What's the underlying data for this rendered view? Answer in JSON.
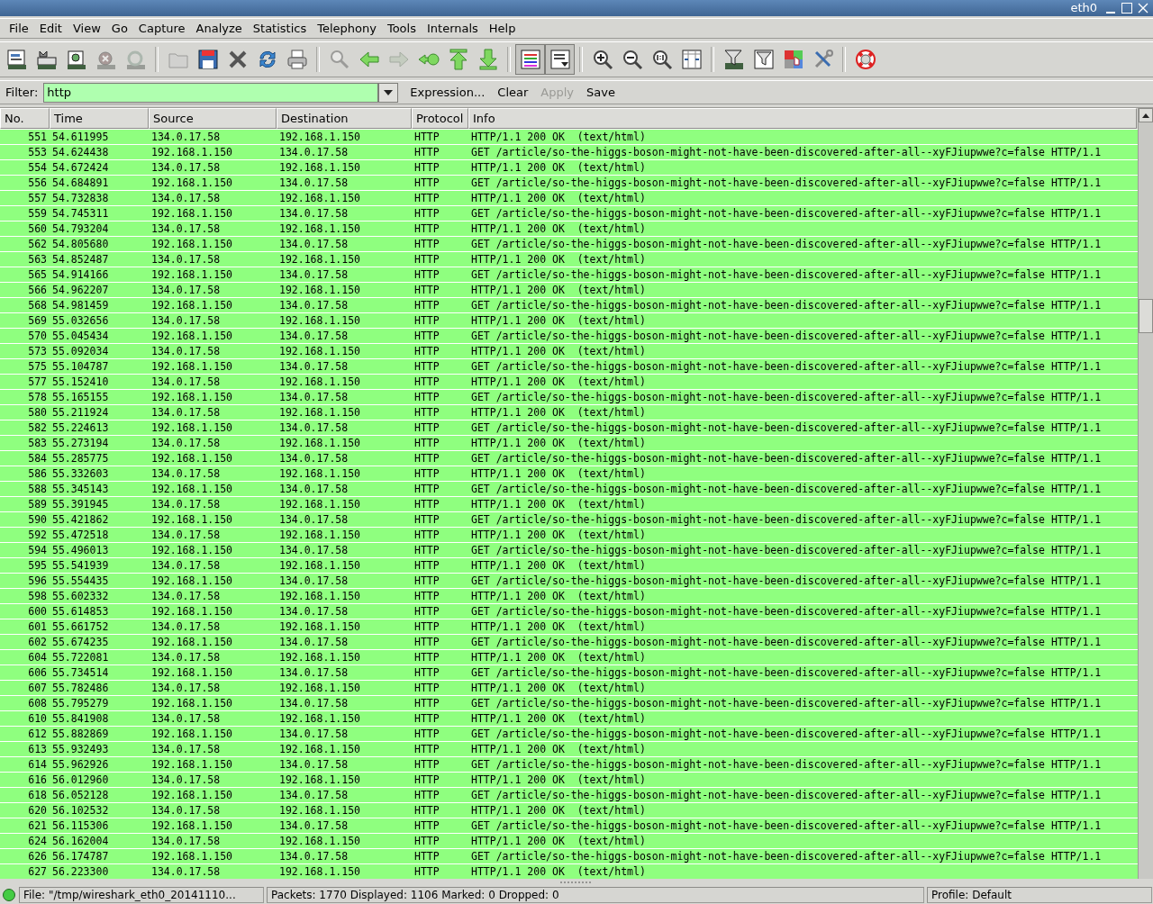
{
  "window": {
    "title": "eth0"
  },
  "menu": [
    {
      "label": "File",
      "selected": false
    },
    {
      "label": "Edit",
      "selected": false
    },
    {
      "label": "View",
      "selected": false
    },
    {
      "label": "Go",
      "selected": false
    },
    {
      "label": "Capture",
      "selected": false
    },
    {
      "label": "Analyze",
      "selected": false
    },
    {
      "label": "Statistics",
      "selected": false
    },
    {
      "label": "Telephony",
      "selected": false
    },
    {
      "label": "Tools",
      "selected": false
    },
    {
      "label": "Internals",
      "selected": false
    },
    {
      "label": "Help",
      "selected": false
    }
  ],
  "toolbar": [
    {
      "kind": "interfaces",
      "disabled": false,
      "pressed": false
    },
    {
      "kind": "options",
      "disabled": false,
      "pressed": false
    },
    {
      "kind": "start",
      "disabled": false,
      "pressed": false
    },
    {
      "kind": "stop",
      "disabled": true,
      "pressed": false
    },
    {
      "kind": "restart",
      "disabled": true,
      "pressed": false
    },
    {
      "kind": "separator"
    },
    {
      "kind": "open",
      "disabled": true,
      "pressed": false
    },
    {
      "kind": "save",
      "disabled": false,
      "pressed": false
    },
    {
      "kind": "close",
      "disabled": false,
      "pressed": false
    },
    {
      "kind": "reload",
      "disabled": false,
      "pressed": false
    },
    {
      "kind": "print",
      "disabled": false,
      "pressed": false
    },
    {
      "kind": "separator"
    },
    {
      "kind": "find",
      "disabled": true,
      "pressed": false
    },
    {
      "kind": "back",
      "disabled": false,
      "pressed": false
    },
    {
      "kind": "forward",
      "disabled": true,
      "pressed": false
    },
    {
      "kind": "goto",
      "disabled": false,
      "pressed": false
    },
    {
      "kind": "first",
      "disabled": false,
      "pressed": false
    },
    {
      "kind": "last",
      "disabled": false,
      "pressed": false
    },
    {
      "kind": "separator"
    },
    {
      "kind": "colorize",
      "disabled": false,
      "pressed": true
    },
    {
      "kind": "autoscroll",
      "disabled": false,
      "pressed": true
    },
    {
      "kind": "separator"
    },
    {
      "kind": "zoomin",
      "disabled": false,
      "pressed": false
    },
    {
      "kind": "zoomout",
      "disabled": false,
      "pressed": false
    },
    {
      "kind": "zoomnormal",
      "disabled": false,
      "pressed": false
    },
    {
      "kind": "resize",
      "disabled": false,
      "pressed": false
    },
    {
      "kind": "separator"
    },
    {
      "kind": "capturefilter",
      "disabled": false,
      "pressed": false
    },
    {
      "kind": "displayfilter",
      "disabled": false,
      "pressed": false
    },
    {
      "kind": "coloring",
      "disabled": false,
      "pressed": false
    },
    {
      "kind": "preferences",
      "disabled": false,
      "pressed": false
    },
    {
      "kind": "separator"
    },
    {
      "kind": "help",
      "disabled": false,
      "pressed": false
    }
  ],
  "filter": {
    "label": "Filter:",
    "value": "http",
    "valid": true,
    "buttons": [
      {
        "label": "Expression...",
        "disabled": false
      },
      {
        "label": "Clear",
        "disabled": false
      },
      {
        "label": "Apply",
        "disabled": true
      },
      {
        "label": "Save",
        "disabled": false
      }
    ]
  },
  "table": {
    "columns": [
      "No.",
      "Time",
      "Source",
      "Destination",
      "Protocol",
      "Info"
    ],
    "rows": [
      {
        "color": "#8fff7f",
        "cells": [
          "551",
          "54.611995",
          "134.0.17.58",
          "192.168.1.150",
          "HTTP",
          "HTTP/1.1 200 OK  (text/html)"
        ]
      },
      {
        "color": "#8fff7f",
        "cells": [
          "553",
          "54.624438",
          "192.168.1.150",
          "134.0.17.58",
          "HTTP",
          "GET /article/so-the-higgs-boson-might-not-have-been-discovered-after-all--xyFJiupwwe?c=false HTTP/1.1"
        ]
      },
      {
        "color": "#8fff7f",
        "cells": [
          "554",
          "54.672424",
          "134.0.17.58",
          "192.168.1.150",
          "HTTP",
          "HTTP/1.1 200 OK  (text/html)"
        ]
      },
      {
        "color": "#8fff7f",
        "cells": [
          "556",
          "54.684891",
          "192.168.1.150",
          "134.0.17.58",
          "HTTP",
          "GET /article/so-the-higgs-boson-might-not-have-been-discovered-after-all--xyFJiupwwe?c=false HTTP/1.1"
        ]
      },
      {
        "color": "#8fff7f",
        "cells": [
          "557",
          "54.732838",
          "134.0.17.58",
          "192.168.1.150",
          "HTTP",
          "HTTP/1.1 200 OK  (text/html)"
        ]
      },
      {
        "color": "#8fff7f",
        "cells": [
          "559",
          "54.745311",
          "192.168.1.150",
          "134.0.17.58",
          "HTTP",
          "GET /article/so-the-higgs-boson-might-not-have-been-discovered-after-all--xyFJiupwwe?c=false HTTP/1.1"
        ]
      },
      {
        "color": "#8fff7f",
        "cells": [
          "560",
          "54.793204",
          "134.0.17.58",
          "192.168.1.150",
          "HTTP",
          "HTTP/1.1 200 OK  (text/html)"
        ]
      },
      {
        "color": "#8fff7f",
        "cells": [
          "562",
          "54.805680",
          "192.168.1.150",
          "134.0.17.58",
          "HTTP",
          "GET /article/so-the-higgs-boson-might-not-have-been-discovered-after-all--xyFJiupwwe?c=false HTTP/1.1"
        ]
      },
      {
        "color": "#8fff7f",
        "cells": [
          "563",
          "54.852487",
          "134.0.17.58",
          "192.168.1.150",
          "HTTP",
          "HTTP/1.1 200 OK  (text/html)"
        ]
      },
      {
        "color": "#8fff7f",
        "cells": [
          "565",
          "54.914166",
          "192.168.1.150",
          "134.0.17.58",
          "HTTP",
          "GET /article/so-the-higgs-boson-might-not-have-been-discovered-after-all--xyFJiupwwe?c=false HTTP/1.1"
        ]
      },
      {
        "color": "#8fff7f",
        "cells": [
          "566",
          "54.962207",
          "134.0.17.58",
          "192.168.1.150",
          "HTTP",
          "HTTP/1.1 200 OK  (text/html)"
        ]
      },
      {
        "color": "#8fff7f",
        "cells": [
          "568",
          "54.981459",
          "192.168.1.150",
          "134.0.17.58",
          "HTTP",
          "GET /article/so-the-higgs-boson-might-not-have-been-discovered-after-all--xyFJiupwwe?c=false HTTP/1.1"
        ]
      },
      {
        "color": "#8fff7f",
        "cells": [
          "569",
          "55.032656",
          "134.0.17.58",
          "192.168.1.150",
          "HTTP",
          "HTTP/1.1 200 OK  (text/html)"
        ]
      },
      {
        "color": "#8fff7f",
        "cells": [
          "570",
          "55.045434",
          "192.168.1.150",
          "134.0.17.58",
          "HTTP",
          "GET /article/so-the-higgs-boson-might-not-have-been-discovered-after-all--xyFJiupwwe?c=false HTTP/1.1"
        ]
      },
      {
        "color": "#8fff7f",
        "cells": [
          "573",
          "55.092034",
          "134.0.17.58",
          "192.168.1.150",
          "HTTP",
          "HTTP/1.1 200 OK  (text/html)"
        ]
      },
      {
        "color": "#8fff7f",
        "cells": [
          "575",
          "55.104787",
          "192.168.1.150",
          "134.0.17.58",
          "HTTP",
          "GET /article/so-the-higgs-boson-might-not-have-been-discovered-after-all--xyFJiupwwe?c=false HTTP/1.1"
        ]
      },
      {
        "color": "#8fff7f",
        "cells": [
          "577",
          "55.152410",
          "134.0.17.58",
          "192.168.1.150",
          "HTTP",
          "HTTP/1.1 200 OK  (text/html)"
        ]
      },
      {
        "color": "#8fff7f",
        "cells": [
          "578",
          "55.165155",
          "192.168.1.150",
          "134.0.17.58",
          "HTTP",
          "GET /article/so-the-higgs-boson-might-not-have-been-discovered-after-all--xyFJiupwwe?c=false HTTP/1.1"
        ]
      },
      {
        "color": "#8fff7f",
        "cells": [
          "580",
          "55.211924",
          "134.0.17.58",
          "192.168.1.150",
          "HTTP",
          "HTTP/1.1 200 OK  (text/html)"
        ]
      },
      {
        "color": "#8fff7f",
        "cells": [
          "582",
          "55.224613",
          "192.168.1.150",
          "134.0.17.58",
          "HTTP",
          "GET /article/so-the-higgs-boson-might-not-have-been-discovered-after-all--xyFJiupwwe?c=false HTTP/1.1"
        ]
      },
      {
        "color": "#8fff7f",
        "cells": [
          "583",
          "55.273194",
          "134.0.17.58",
          "192.168.1.150",
          "HTTP",
          "HTTP/1.1 200 OK  (text/html)"
        ]
      },
      {
        "color": "#8fff7f",
        "cells": [
          "584",
          "55.285775",
          "192.168.1.150",
          "134.0.17.58",
          "HTTP",
          "GET /article/so-the-higgs-boson-might-not-have-been-discovered-after-all--xyFJiupwwe?c=false HTTP/1.1"
        ]
      },
      {
        "color": "#8fff7f",
        "cells": [
          "586",
          "55.332603",
          "134.0.17.58",
          "192.168.1.150",
          "HTTP",
          "HTTP/1.1 200 OK  (text/html)"
        ]
      },
      {
        "color": "#8fff7f",
        "cells": [
          "588",
          "55.345143",
          "192.168.1.150",
          "134.0.17.58",
          "HTTP",
          "GET /article/so-the-higgs-boson-might-not-have-been-discovered-after-all--xyFJiupwwe?c=false HTTP/1.1"
        ]
      },
      {
        "color": "#8fff7f",
        "cells": [
          "589",
          "55.391945",
          "134.0.17.58",
          "192.168.1.150",
          "HTTP",
          "HTTP/1.1 200 OK  (text/html)"
        ]
      },
      {
        "color": "#8fff7f",
        "cells": [
          "590",
          "55.421862",
          "192.168.1.150",
          "134.0.17.58",
          "HTTP",
          "GET /article/so-the-higgs-boson-might-not-have-been-discovered-after-all--xyFJiupwwe?c=false HTTP/1.1"
        ]
      },
      {
        "color": "#8fff7f",
        "cells": [
          "592",
          "55.472518",
          "134.0.17.58",
          "192.168.1.150",
          "HTTP",
          "HTTP/1.1 200 OK  (text/html)"
        ]
      },
      {
        "color": "#8fff7f",
        "cells": [
          "594",
          "55.496013",
          "192.168.1.150",
          "134.0.17.58",
          "HTTP",
          "GET /article/so-the-higgs-boson-might-not-have-been-discovered-after-all--xyFJiupwwe?c=false HTTP/1.1"
        ]
      },
      {
        "color": "#8fff7f",
        "cells": [
          "595",
          "55.541939",
          "134.0.17.58",
          "192.168.1.150",
          "HTTP",
          "HTTP/1.1 200 OK  (text/html)"
        ]
      },
      {
        "color": "#8fff7f",
        "cells": [
          "596",
          "55.554435",
          "192.168.1.150",
          "134.0.17.58",
          "HTTP",
          "GET /article/so-the-higgs-boson-might-not-have-been-discovered-after-all--xyFJiupwwe?c=false HTTP/1.1"
        ]
      },
      {
        "color": "#8fff7f",
        "cells": [
          "598",
          "55.602332",
          "134.0.17.58",
          "192.168.1.150",
          "HTTP",
          "HTTP/1.1 200 OK  (text/html)"
        ]
      },
      {
        "color": "#8fff7f",
        "cells": [
          "600",
          "55.614853",
          "192.168.1.150",
          "134.0.17.58",
          "HTTP",
          "GET /article/so-the-higgs-boson-might-not-have-been-discovered-after-all--xyFJiupwwe?c=false HTTP/1.1"
        ]
      },
      {
        "color": "#8fff7f",
        "cells": [
          "601",
          "55.661752",
          "134.0.17.58",
          "192.168.1.150",
          "HTTP",
          "HTTP/1.1 200 OK  (text/html)"
        ]
      },
      {
        "color": "#8fff7f",
        "cells": [
          "602",
          "55.674235",
          "192.168.1.150",
          "134.0.17.58",
          "HTTP",
          "GET /article/so-the-higgs-boson-might-not-have-been-discovered-after-all--xyFJiupwwe?c=false HTTP/1.1"
        ]
      },
      {
        "color": "#8fff7f",
        "cells": [
          "604",
          "55.722081",
          "134.0.17.58",
          "192.168.1.150",
          "HTTP",
          "HTTP/1.1 200 OK  (text/html)"
        ]
      },
      {
        "color": "#8fff7f",
        "cells": [
          "606",
          "55.734514",
          "192.168.1.150",
          "134.0.17.58",
          "HTTP",
          "GET /article/so-the-higgs-boson-might-not-have-been-discovered-after-all--xyFJiupwwe?c=false HTTP/1.1"
        ]
      },
      {
        "color": "#8fff7f",
        "cells": [
          "607",
          "55.782486",
          "134.0.17.58",
          "192.168.1.150",
          "HTTP",
          "HTTP/1.1 200 OK  (text/html)"
        ]
      },
      {
        "color": "#8fff7f",
        "cells": [
          "608",
          "55.795279",
          "192.168.1.150",
          "134.0.17.58",
          "HTTP",
          "GET /article/so-the-higgs-boson-might-not-have-been-discovered-after-all--xyFJiupwwe?c=false HTTP/1.1"
        ]
      },
      {
        "color": "#8fff7f",
        "cells": [
          "610",
          "55.841908",
          "134.0.17.58",
          "192.168.1.150",
          "HTTP",
          "HTTP/1.1 200 OK  (text/html)"
        ]
      },
      {
        "color": "#8fff7f",
        "cells": [
          "612",
          "55.882869",
          "192.168.1.150",
          "134.0.17.58",
          "HTTP",
          "GET /article/so-the-higgs-boson-might-not-have-been-discovered-after-all--xyFJiupwwe?c=false HTTP/1.1"
        ]
      },
      {
        "color": "#8fff7f",
        "cells": [
          "613",
          "55.932493",
          "134.0.17.58",
          "192.168.1.150",
          "HTTP",
          "HTTP/1.1 200 OK  (text/html)"
        ]
      },
      {
        "color": "#8fff7f",
        "cells": [
          "614",
          "55.962926",
          "192.168.1.150",
          "134.0.17.58",
          "HTTP",
          "GET /article/so-the-higgs-boson-might-not-have-been-discovered-after-all--xyFJiupwwe?c=false HTTP/1.1"
        ]
      },
      {
        "color": "#8fff7f",
        "cells": [
          "616",
          "56.012960",
          "134.0.17.58",
          "192.168.1.150",
          "HTTP",
          "HTTP/1.1 200 OK  (text/html)"
        ]
      },
      {
        "color": "#8fff7f",
        "cells": [
          "618",
          "56.052128",
          "192.168.1.150",
          "134.0.17.58",
          "HTTP",
          "GET /article/so-the-higgs-boson-might-not-have-been-discovered-after-all--xyFJiupwwe?c=false HTTP/1.1"
        ]
      },
      {
        "color": "#8fff7f",
        "cells": [
          "620",
          "56.102532",
          "134.0.17.58",
          "192.168.1.150",
          "HTTP",
          "HTTP/1.1 200 OK  (text/html)"
        ]
      },
      {
        "color": "#8fff7f",
        "cells": [
          "621",
          "56.115306",
          "192.168.1.150",
          "134.0.17.58",
          "HTTP",
          "GET /article/so-the-higgs-boson-might-not-have-been-discovered-after-all--xyFJiupwwe?c=false HTTP/1.1"
        ]
      },
      {
        "color": "#8fff7f",
        "cells": [
          "624",
          "56.162004",
          "134.0.17.58",
          "192.168.1.150",
          "HTTP",
          "HTTP/1.1 200 OK  (text/html)"
        ]
      },
      {
        "color": "#8fff7f",
        "cells": [
          "626",
          "56.174787",
          "192.168.1.150",
          "134.0.17.58",
          "HTTP",
          "GET /article/so-the-higgs-boson-might-not-have-been-discovered-after-all--xyFJiupwwe?c=false HTTP/1.1"
        ]
      },
      {
        "color": "#8fff7f",
        "cells": [
          "627",
          "56.223300",
          "134.0.17.58",
          "192.168.1.150",
          "HTTP",
          "HTTP/1.1 200 OK  (text/html)"
        ]
      }
    ]
  },
  "status_bar": {
    "file": "File: \"/tmp/wireshark_eth0_20141110...",
    "packets": "Packets: 1770 Displayed: 1106 Marked: 0 Dropped: 0",
    "profile": "Profile: Default"
  }
}
